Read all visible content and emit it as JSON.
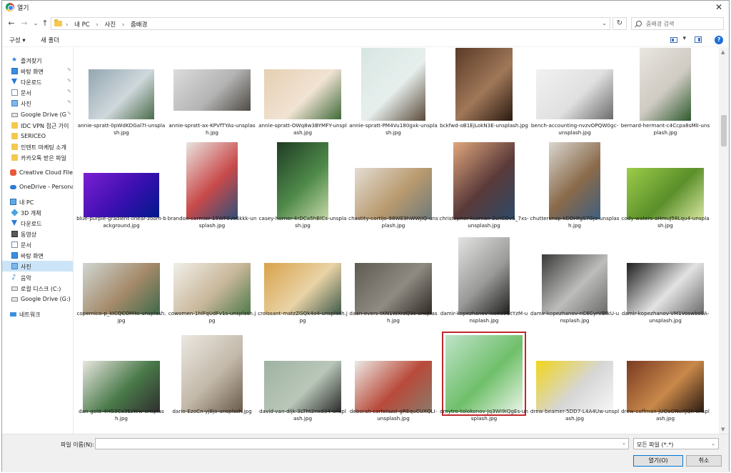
{
  "window": {
    "title": "열기",
    "close_glyph": "✕"
  },
  "nav": {
    "back_glyph": "←",
    "forward_glyph": "→",
    "dropdown_glyph": "⌄",
    "up_glyph": "↑",
    "refresh_glyph": "↻"
  },
  "address": {
    "crumbs": [
      "내 PC",
      "사진",
      "줌배경"
    ],
    "separator": "›"
  },
  "search": {
    "placeholder": "줌배경 검색"
  },
  "toolbar": {
    "organize_label": "구성 ▾",
    "new_folder_label": "새 폴더",
    "view_drop_glyph": "▾",
    "help_label": "?"
  },
  "sidebar": {
    "items": [
      {
        "label": "즐겨찾기",
        "icon": "star-icon"
      },
      {
        "label": "바탕 화면",
        "icon": "desktop-icon",
        "pinned": true
      },
      {
        "label": "다운로드",
        "icon": "download-icon",
        "pinned": true
      },
      {
        "label": "문서",
        "icon": "document-icon",
        "pinned": true
      },
      {
        "label": "사진",
        "icon": "pictures-icon",
        "pinned": true
      },
      {
        "label": "Google Drive (G",
        "icon": "drive-icon",
        "pinned": true
      },
      {
        "label": "IDC VPN 접근 가이",
        "icon": "folder-icon"
      },
      {
        "label": "SERICEO",
        "icon": "folder-icon"
      },
      {
        "label": "인텐트 마케팅 소개",
        "icon": "folder-icon"
      },
      {
        "label": "카카오톡 받은 파일",
        "icon": "folder-icon"
      },
      {
        "label": "Creative Cloud Files",
        "icon": "creative-cloud-icon"
      },
      {
        "label": "OneDrive - Personal",
        "icon": "onedrive-icon"
      },
      {
        "label": "내 PC",
        "icon": "pc-icon"
      },
      {
        "label": "3D 개체",
        "icon": "3d-objects-icon"
      },
      {
        "label": "다운로드",
        "icon": "download-icon"
      },
      {
        "label": "동영상",
        "icon": "video-icon"
      },
      {
        "label": "문서",
        "icon": "document-icon"
      },
      {
        "label": "바탕 화면",
        "icon": "desktop-icon"
      },
      {
        "label": "사진",
        "icon": "pictures-icon",
        "selected": true
      },
      {
        "label": "음악",
        "icon": "music-icon"
      },
      {
        "label": "로컬 디스크 (C:)",
        "icon": "drive-icon"
      },
      {
        "label": "Google Drive (G:)",
        "icon": "drive-icon"
      },
      {
        "label": "네트워크",
        "icon": "network-icon"
      }
    ],
    "pin_glyph": "✎"
  },
  "scrollbar": {
    "up_glyph": "▲",
    "down_glyph": "▼"
  },
  "files": [
    {
      "name": "annie-spratt-0pWdKDGal7I-unsplash.jpg",
      "colors": [
        "#93a6b1",
        "#cfd8dc",
        "#4b6b4a"
      ]
    },
    {
      "name": "annie-spratt-ax-KPVfTYAs-unsplash.jpg",
      "colors": [
        "#dcdcdc",
        "#b4b4b4",
        "#4f4a44"
      ]
    },
    {
      "name": "annie-spratt-OWq8w3BYMFY-unsplash.jpg",
      "colors": [
        "#e6cfb2",
        "#f1e3d3",
        "#3f6a3a"
      ]
    },
    {
      "name": "annie-spratt-PM4Vu180gxk-unsplash.jpg",
      "colors": [
        "#d7e6e2",
        "#e7efed",
        "#5a4a3a"
      ]
    },
    {
      "name": "bckfwd-oB1EjLokN3E-unsplash.jpg",
      "colors": [
        "#5a3a28",
        "#a07858",
        "#2a1a12"
      ]
    },
    {
      "name": "bench-accounting-nvzvOPQW0gc-unsplash.jpg",
      "colors": [
        "#f2f2f2",
        "#e0e0e0",
        "#6c6c6c"
      ]
    },
    {
      "name": "bernard-hermant-c4Ccpa8sMlI-unsplash.jpg",
      "colors": [
        "#e9e6e0",
        "#cfcac2",
        "#2f5a2f"
      ]
    },
    {
      "name": "blue-purple-gradient-linear-zoom-background.jpg",
      "colors": [
        "#7b1fd1",
        "#3a0fb0",
        "#001a8c"
      ]
    },
    {
      "name": "brandon-cormier-15WF6Ve6kkk-unsplash.jpg",
      "colors": [
        "#e9e4df",
        "#c94a4a",
        "#2f4f7a"
      ]
    },
    {
      "name": "casey-horner-4rDCa5hBlCs-unsplash.jpg",
      "colors": [
        "#1f3d24",
        "#4f8a4a",
        "#c6d8a8"
      ]
    },
    {
      "name": "chastity-cortijo-98WE9hWWjiQ-unsplash.jpg",
      "colors": [
        "#e3ddd3",
        "#b99a6f",
        "#6f7a7a"
      ]
    },
    {
      "name": "christopher-kuzman-2LhCDvS_7xs-unsplash.jpg",
      "colors": [
        "#e0a77c",
        "#5a3a3a",
        "#2e4a66"
      ]
    },
    {
      "name": "chuttersnap-kDDHfgS7Gjo-unsplash.jpg",
      "colors": [
        "#d9d6cf",
        "#8a6a4a",
        "#3f5f7f"
      ]
    },
    {
      "name": "cody-waters-aHmuJ58Lqu4-unsplash.jpg",
      "colors": [
        "#9ccc4a",
        "#5a8f2a",
        "#d8e6a0"
      ]
    },
    {
      "name": "copernico-p_kICQCOM4s-unsplash.jpg",
      "colors": [
        "#cfd6d2",
        "#a58a6a",
        "#3f6a4a"
      ]
    },
    {
      "name": "cowomen-1hlFqUdFv1s-unsplash.jpg",
      "colors": [
        "#f1efe9",
        "#c8b79a",
        "#4f7a4a"
      ]
    },
    {
      "name": "croissant-matzZGQk4o4-unsplash.jpg",
      "colors": [
        "#d8a24a",
        "#e9d3a6",
        "#3f5a4a"
      ]
    },
    {
      "name": "daan-evers-tKN1WXrzQ3s-unsplash.jpg",
      "colors": [
        "#5f5a52",
        "#8f8a82",
        "#2f2a24"
      ]
    },
    {
      "name": "damir-kopezhanov-luseu9GtYzM-unsplash.jpg",
      "colors": [
        "#e3e3e1",
        "#9a9a98",
        "#1f1f1f"
      ]
    },
    {
      "name": "damir-kopezhanov-nC6CyrVBtkU-unsplash.jpg",
      "colors": [
        "#3a3a38",
        "#bdbdbb",
        "#6a6a68"
      ]
    },
    {
      "name": "damir-kopezhanov-VM1Voswbs0A-unsplash.jpg",
      "colors": [
        "#1f1f1f",
        "#e3e3e3",
        "#6a6a6a"
      ]
    },
    {
      "name": "dan-gold-4HG3Ca3EzWw-unsplash.jpg",
      "colors": [
        "#e9e6df",
        "#4a7a4a",
        "#2f2f2f"
      ]
    },
    {
      "name": "dario-EzoCn-yj8jo-unsplash.jpg",
      "colors": [
        "#ece8e2",
        "#c2b8a8",
        "#6a5a4a"
      ]
    },
    {
      "name": "david-van-dijk-3LTht2nxd34-unsplash.jpg",
      "colors": [
        "#9fb2a2",
        "#b9c7b9",
        "#2a2a2a"
      ]
    },
    {
      "name": "deborah-cortelazzi-gREquCUXQLI-unsplash.jpg",
      "colors": [
        "#eceae6",
        "#b94a3a",
        "#8a7a6a"
      ]
    },
    {
      "name": "dmytro-tolokonov-Jq3WI9IQgEs-unsplash.jpg",
      "colors": [
        "#bfe3c9",
        "#6fbf6a",
        "#eaf5e8"
      ],
      "selected": true
    },
    {
      "name": "drew-beamer-5DD7-L4A4Uw-unsplash.jpg",
      "colors": [
        "#f2d51a",
        "#d6d6d6",
        "#f6f6f6"
      ]
    },
    {
      "name": "drew-coffman-jUOaONoXJQk-unsplash.jpg",
      "colors": [
        "#7a3a22",
        "#c9894a",
        "#2a1a12"
      ]
    }
  ],
  "bottom": {
    "filename_label": "파일 이름(N):",
    "filename_value": "",
    "filename_drop_glyph": "⌄",
    "filetype_value": "모든 파일 (*.*)",
    "filetype_drop_glyph": "⌄",
    "open_label": "열기(O)",
    "cancel_label": "취소"
  }
}
